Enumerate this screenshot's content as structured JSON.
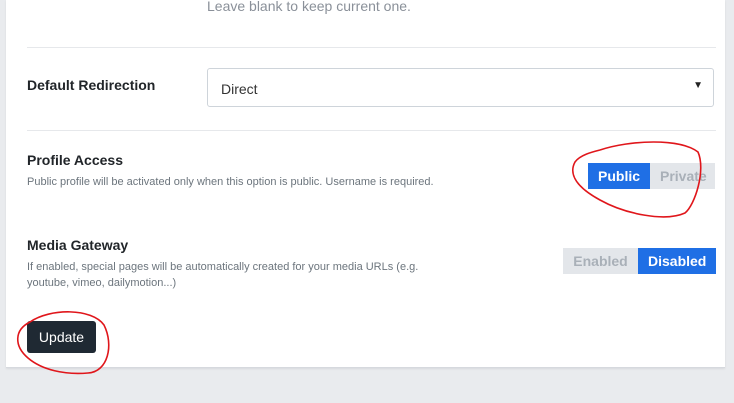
{
  "password_hint": "Leave blank to keep current one.",
  "redirection": {
    "label": "Default Redirection",
    "selected": "Direct"
  },
  "profile_access": {
    "label": "Profile Access",
    "help": "Public profile will be activated only when this option is public. Username is required.",
    "options": [
      "Public",
      "Private"
    ],
    "selected": "Public"
  },
  "media_gateway": {
    "label": "Media Gateway",
    "help_line1": "If enabled, special pages will be automatically created for your media URLs (e.g.",
    "help_line2": "youtube, vimeo, dailymotion...)",
    "options": [
      "Enabled",
      "Disabled"
    ],
    "selected": "Disabled"
  },
  "update_button": "Update",
  "colors": {
    "accent": "#1f6fe5",
    "annotation": "#e0161b",
    "button_dark": "#1f2933"
  }
}
